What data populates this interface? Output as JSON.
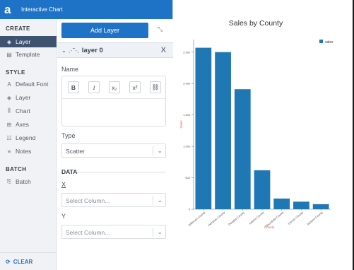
{
  "app": {
    "logo": "a",
    "title": "Interactive Chart"
  },
  "sidebar": {
    "create_heading": "CREATE",
    "create_items": [
      {
        "label": "Layer",
        "icon": "layers-icon",
        "glyph": "◈"
      },
      {
        "label": "Template",
        "icon": "template-icon",
        "glyph": "▤"
      }
    ],
    "style_heading": "STYLE",
    "style_items": [
      {
        "label": "Default Font",
        "icon": "font-icon",
        "glyph": "A"
      },
      {
        "label": "Layer",
        "icon": "layers-icon",
        "glyph": "◈"
      },
      {
        "label": "Chart",
        "icon": "chart-icon",
        "glyph": "⫼"
      },
      {
        "label": "Axes",
        "icon": "axes-icon",
        "glyph": "⊞"
      },
      {
        "label": "Legend",
        "icon": "legend-icon",
        "glyph": "☷"
      },
      {
        "label": "Notes",
        "icon": "notes-icon",
        "glyph": "≡"
      }
    ],
    "batch_heading": "BATCH",
    "batch_items": [
      {
        "label": "Batch",
        "icon": "batch-icon",
        "glyph": "⎘"
      }
    ],
    "clear_label": "CLEAR",
    "clear_glyph": "⟳"
  },
  "editor": {
    "add_layer_label": "Add Layer",
    "collapse_glyph": "⤡",
    "layer_name": "layer 0",
    "layer_chevron": "⌄",
    "layer_type_glyph": "⋰⋱",
    "close_glyph": "X",
    "name_label": "Name",
    "format_buttons": [
      {
        "name": "bold-button",
        "glyph": "B"
      },
      {
        "name": "italic-button",
        "glyph": "I"
      },
      {
        "name": "subscript-button",
        "glyph": "x₂"
      },
      {
        "name": "superscript-button",
        "glyph": "x²"
      },
      {
        "name": "link-button",
        "glyph": "⛓"
      }
    ],
    "type_label": "Type",
    "type_value": "Scatter",
    "data_heading": "DATA",
    "x_label": "X",
    "x_placeholder": "Select Column...",
    "y_label": "Y",
    "y_placeholder": "Select Column...",
    "chevron_glyph": "⌄"
  },
  "chart_data": {
    "type": "bar",
    "title": "Sales by County",
    "xlabel": "County",
    "ylabel": "Sales",
    "legend": "sales",
    "legend_position": "top-right",
    "bar_color": "#1f77b4",
    "axis_label_color": "#e45c5c",
    "ylim": [
      0,
      2.7
    ],
    "yticks": [
      0,
      0.5,
      1.0,
      1.5,
      2.0,
      2.5
    ],
    "ytick_labels": [
      "0",
      "500",
      "1.00k",
      "1.50k",
      "2.00k",
      "2.50k"
    ],
    "categories": [
      "Jefferson County",
      "Hampton County",
      "Douglas County",
      "Adams County",
      "Bloomfield County",
      "Denver County",
      "Jackson County"
    ],
    "values": [
      2.57,
      2.5,
      1.91,
      0.62,
      0.17,
      0.12,
      0.08
    ],
    "grid": false
  }
}
